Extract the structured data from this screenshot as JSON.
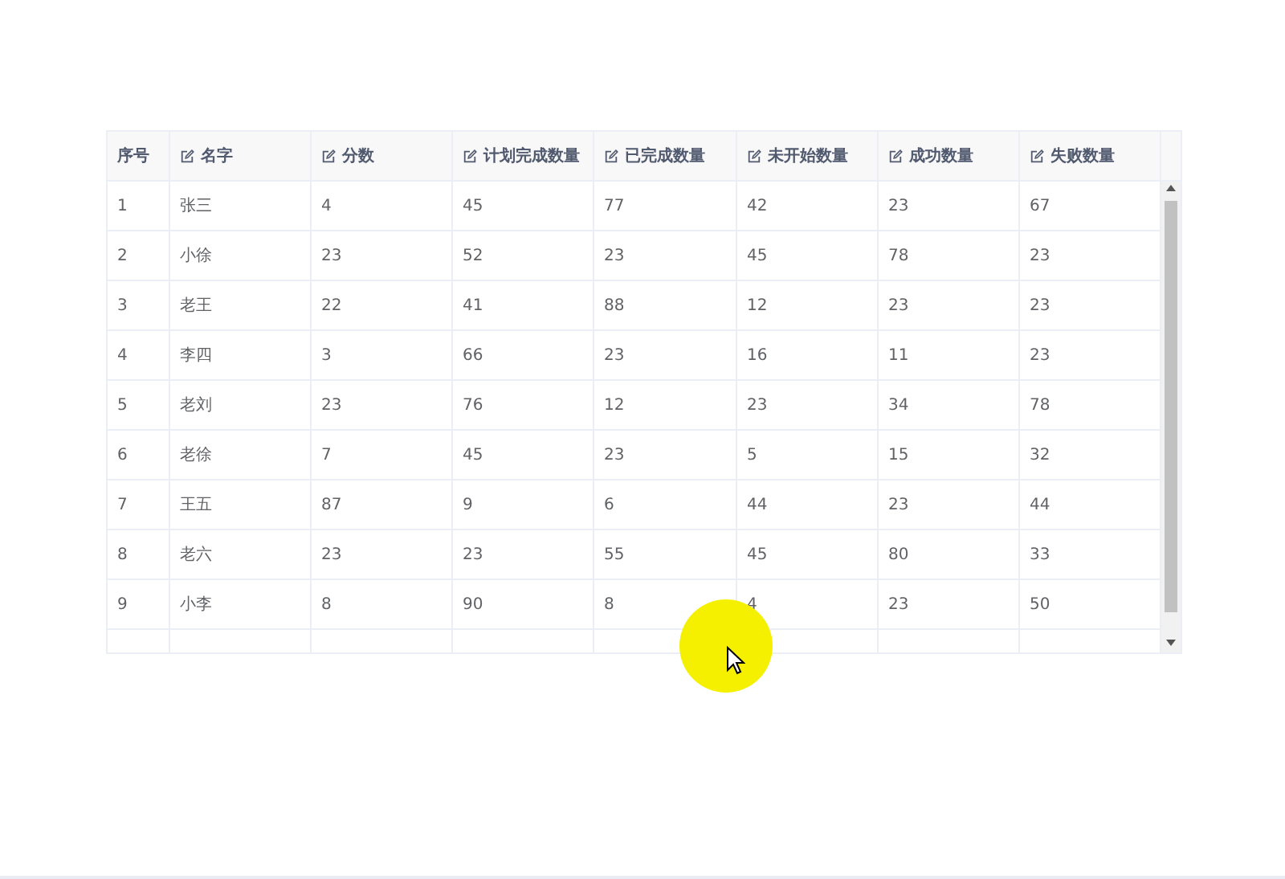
{
  "table": {
    "columns": [
      {
        "label": "序号",
        "editable": false
      },
      {
        "label": "名字",
        "editable": true
      },
      {
        "label": "分数",
        "editable": true
      },
      {
        "label": "计划完成数量",
        "editable": true
      },
      {
        "label": "已完成数量",
        "editable": true
      },
      {
        "label": "未开始数量",
        "editable": true
      },
      {
        "label": "成功数量",
        "editable": true
      },
      {
        "label": "失败数量",
        "editable": true
      }
    ],
    "rows": [
      [
        "1",
        "张三",
        "4",
        "45",
        "77",
        "42",
        "23",
        "67"
      ],
      [
        "2",
        "小徐",
        "23",
        "52",
        "23",
        "45",
        "78",
        "23"
      ],
      [
        "3",
        "老王",
        "22",
        "41",
        "88",
        "12",
        "23",
        "23"
      ],
      [
        "4",
        "李四",
        "3",
        "66",
        "23",
        "16",
        "11",
        "23"
      ],
      [
        "5",
        "老刘",
        "23",
        "76",
        "12",
        "23",
        "34",
        "78"
      ],
      [
        "6",
        "老徐",
        "7",
        "45",
        "23",
        "5",
        "15",
        "32"
      ],
      [
        "7",
        "王五",
        "87",
        "9",
        "6",
        "44",
        "23",
        "44"
      ],
      [
        "8",
        "老六",
        "23",
        "23",
        "55",
        "45",
        "80",
        "33"
      ],
      [
        "9",
        "小李",
        "8",
        "90",
        "8",
        "4",
        "23",
        "50"
      ]
    ]
  }
}
